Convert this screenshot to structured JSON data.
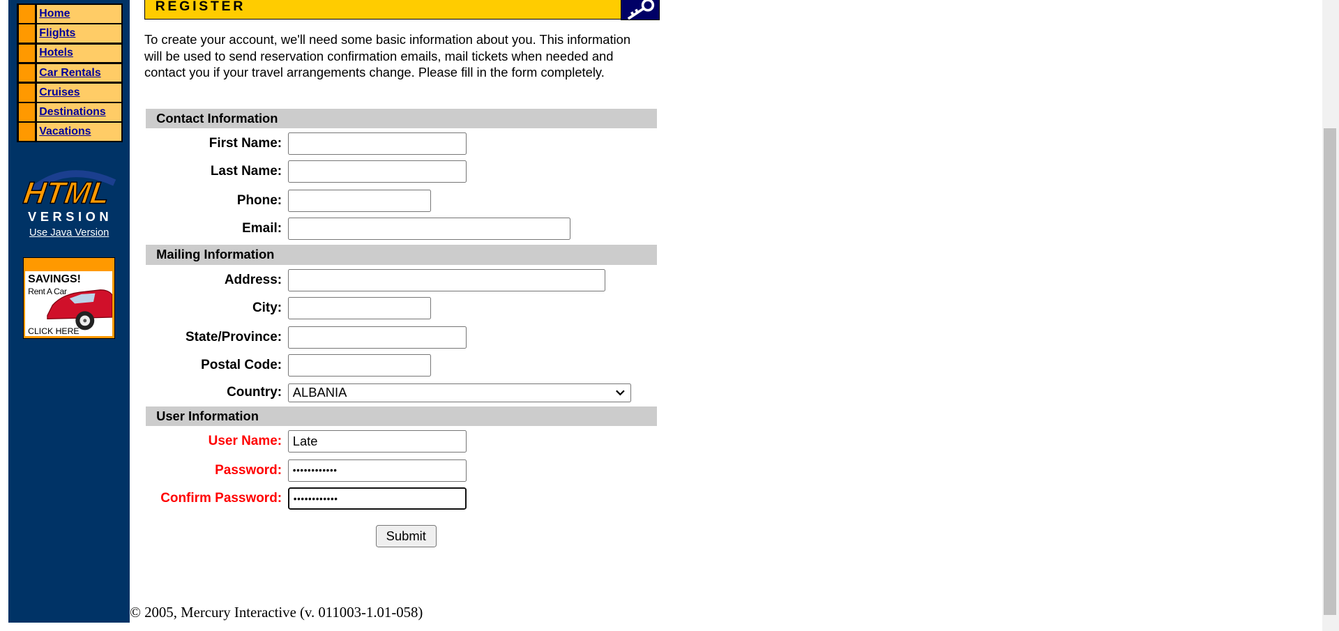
{
  "nav": {
    "items": [
      {
        "label": "Home"
      },
      {
        "label": "Flights"
      },
      {
        "label": "Hotels"
      },
      {
        "label": "Car Rentals"
      },
      {
        "label": "Cruises"
      },
      {
        "label": "Destinations"
      },
      {
        "label": "Vacations"
      }
    ]
  },
  "sidebar": {
    "logo_line1": "HTML",
    "logo_line2": "VERSION",
    "java_link": "Use Java Version",
    "ad_title": "SAVINGS!",
    "ad_subtitle": "Rent A Car",
    "ad_cta": "CLICK HERE"
  },
  "header": {
    "title": "REGISTER"
  },
  "intro": "To create your account, we'll need some basic information about you. This information will be used to send reservation confirmation emails, mail tickets when needed and contact you if your travel arrangements change. Please fill in the form completely.",
  "sections": {
    "contact": "Contact Information",
    "mailing": "Mailing Information",
    "user": "User Information"
  },
  "contact": {
    "first_name_label": "First Name:",
    "first_name_value": "",
    "last_name_label": "Last Name:",
    "last_name_value": "",
    "phone_label": "Phone:",
    "phone_value": "",
    "email_label": "Email:",
    "email_value": ""
  },
  "mailing": {
    "address_label": "Address:",
    "address_value": "",
    "city_label": "City:",
    "city_value": "",
    "state_label": "State/Province:",
    "state_value": "",
    "postal_label": "Postal Code:",
    "postal_value": "",
    "country_label": "Country:",
    "country_value": "ALBANIA"
  },
  "user": {
    "username_label": "User Name:",
    "username_value": "Late",
    "password_label": "Password:",
    "password_value": "••••••••••••",
    "confirm_label": "Confirm Password:",
    "confirm_value": "••••••••••••"
  },
  "submit_label": "Submit",
  "footer": "© 2005, Mercury Interactive (v. 011003-1.01-058)",
  "colors": {
    "sidebar": "#003366",
    "nav_cell": "#ffcc66",
    "nav_marker": "#ff9900",
    "header_bar": "#ffcc00",
    "section_bg": "#cccccc",
    "required_label": "#ff0000"
  }
}
